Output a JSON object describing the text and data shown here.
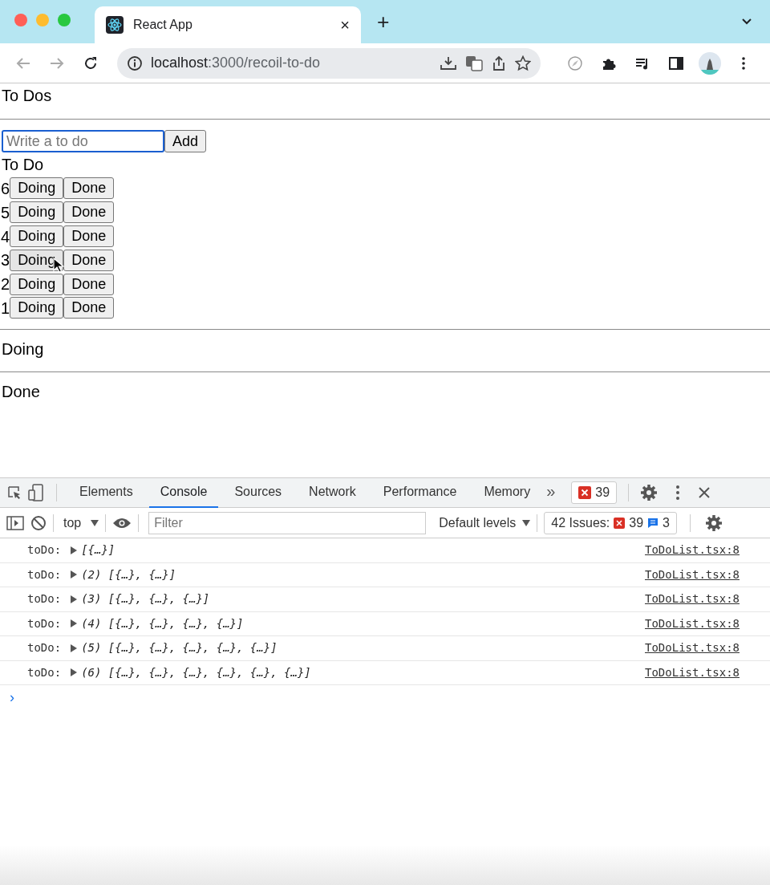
{
  "browser": {
    "tab_title": "React App",
    "tab_close": "×",
    "new_tab": "+",
    "url_host": "localhost",
    "url_path": ":3000/recoil-to-do"
  },
  "page": {
    "title": "To Dos",
    "input": {
      "placeholder": "Write a to do",
      "focused": true
    },
    "add_button": "Add",
    "sections": [
      {
        "title": "To Do",
        "items": [
          {
            "text": "6",
            "buttons": [
              "Doing",
              "Done"
            ],
            "hovered": false
          },
          {
            "text": "5",
            "buttons": [
              "Doing",
              "Done"
            ],
            "hovered": false
          },
          {
            "text": "4",
            "buttons": [
              "Doing",
              "Done"
            ],
            "hovered": false
          },
          {
            "text": "3",
            "buttons": [
              "Doing",
              "Done"
            ],
            "hovered": true
          },
          {
            "text": "2",
            "buttons": [
              "Doing",
              "Done"
            ],
            "hovered": false
          },
          {
            "text": "1",
            "buttons": [
              "Doing",
              "Done"
            ],
            "hovered": false
          }
        ]
      },
      {
        "title": "Doing"
      },
      {
        "title": "Done"
      }
    ]
  },
  "devtools": {
    "tabs": [
      {
        "label": "Elements",
        "selected": false
      },
      {
        "label": "Console",
        "selected": true
      },
      {
        "label": "Sources",
        "selected": false
      },
      {
        "label": "Network",
        "selected": false
      },
      {
        "label": "Performance",
        "selected": false
      },
      {
        "label": "Memory",
        "selected": false
      }
    ],
    "more": "»",
    "error_count": "39",
    "context": "top",
    "filter_placeholder": "Filter",
    "levels": "Default levels",
    "issues_label": "42 Issues:",
    "issues_errors": "39",
    "issues_info": "3",
    "messages": [
      {
        "label": "toDo:",
        "value": "[{…}]",
        "source": "ToDoList.tsx:8"
      },
      {
        "label": "toDo:",
        "value": "(2) [{…}, {…}]",
        "source": "ToDoList.tsx:8"
      },
      {
        "label": "toDo:",
        "value": "(3) [{…}, {…}, {…}]",
        "source": "ToDoList.tsx:8"
      },
      {
        "label": "toDo:",
        "value": "(4) [{…}, {…}, {…}, {…}]",
        "source": "ToDoList.tsx:8"
      },
      {
        "label": "toDo:",
        "value": "(5) [{…}, {…}, {…}, {…}, {…}]",
        "source": "ToDoList.tsx:8"
      },
      {
        "label": "toDo:",
        "value": "(6) [{…}, {…}, {…}, {…}, {…}, {…}]",
        "source": "ToDoList.tsx:8"
      }
    ],
    "prompt": "›"
  }
}
